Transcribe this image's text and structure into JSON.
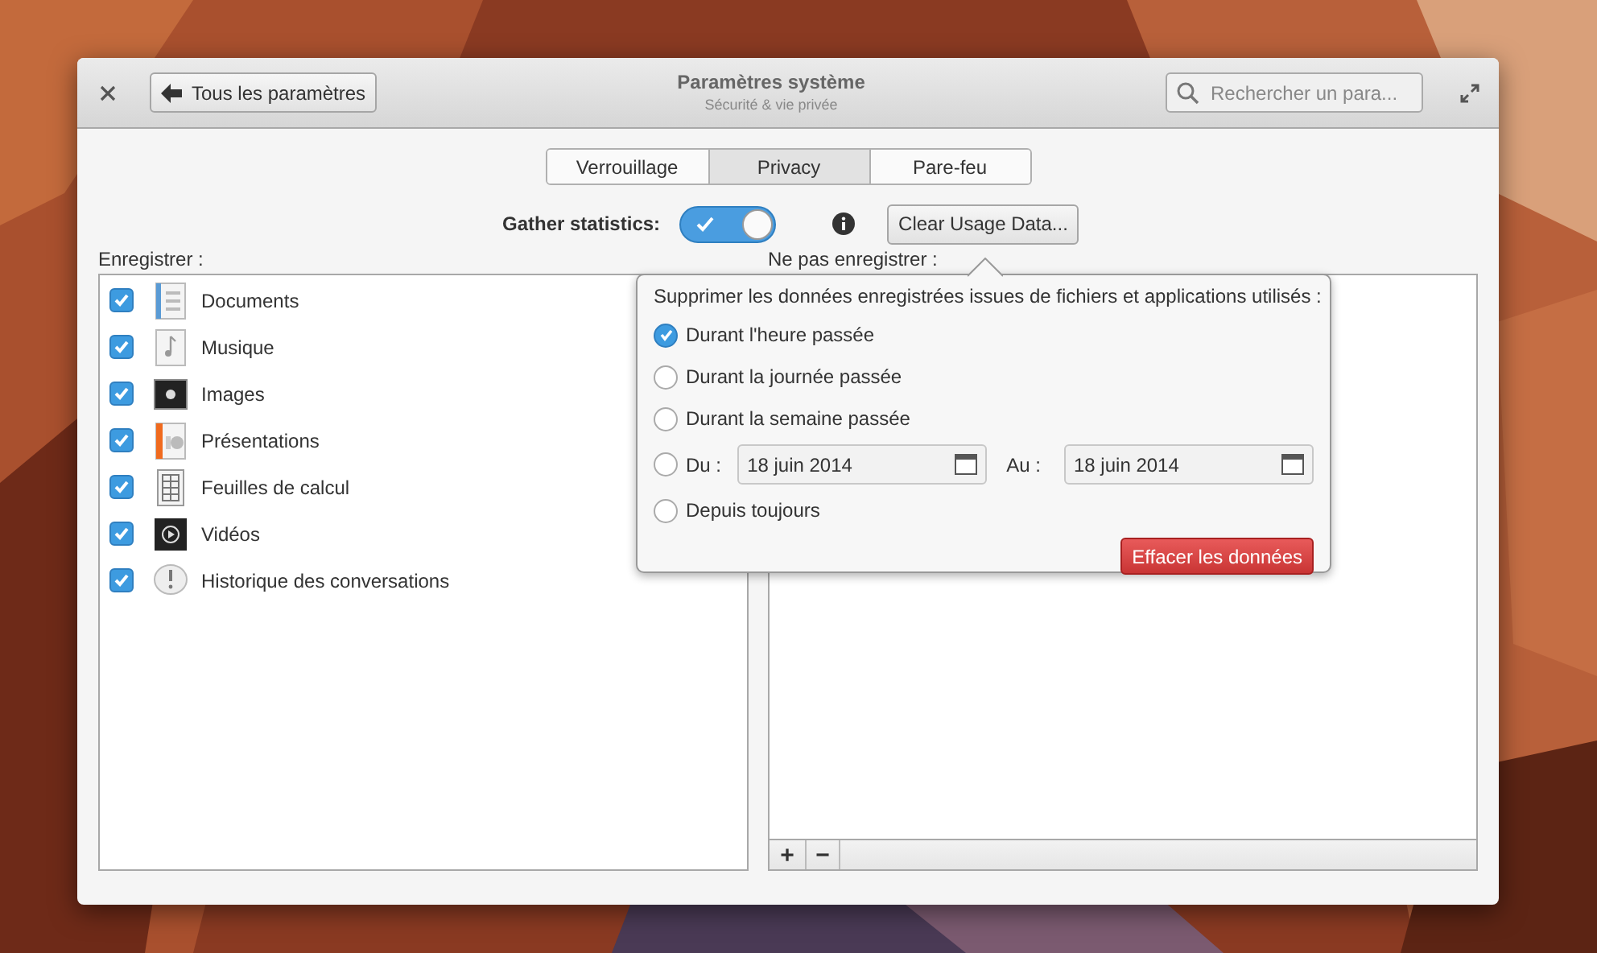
{
  "window": {
    "title": "Paramètres système",
    "subtitle": "Sécurité & vie privée",
    "back_button": "Tous les paramètres",
    "search": {
      "placeholder": "Rechercher un para..."
    }
  },
  "tabs": [
    {
      "label": "Verrouillage",
      "selected": false
    },
    {
      "label": "Privacy",
      "selected": true
    },
    {
      "label": "Pare-feu",
      "selected": false
    }
  ],
  "gather": {
    "label": "Gather statistics:",
    "on": true,
    "clear_button": "Clear Usage Data..."
  },
  "record": {
    "label": "Enregistrer :",
    "items": [
      {
        "label": "Documents",
        "checked": true
      },
      {
        "label": "Musique",
        "checked": true
      },
      {
        "label": "Images",
        "checked": true
      },
      {
        "label": "Présentations",
        "checked": true
      },
      {
        "label": "Feuilles de calcul",
        "checked": true
      },
      {
        "label": "Vidéos",
        "checked": true
      },
      {
        "label": "Historique des conversations",
        "checked": true
      }
    ]
  },
  "exclude": {
    "label": "Ne pas enregistrer :",
    "add": "+",
    "remove": "−"
  },
  "popover": {
    "title": "Supprimer les données enregistrées issues de fichiers et applications utilisés :",
    "options": [
      {
        "kind": "plain",
        "label": "Durant l'heure passée",
        "selected": true
      },
      {
        "kind": "plain",
        "label": "Durant la journée passée",
        "selected": false
      },
      {
        "kind": "plain",
        "label": "Durant la semaine passée",
        "selected": false
      },
      {
        "kind": "range",
        "label": "Du :",
        "from": "18 juin 2014",
        "to_label": "Au :",
        "to": "18 juin 2014",
        "selected": false
      },
      {
        "kind": "plain",
        "label": "Depuis toujours",
        "selected": false
      }
    ],
    "button": "Effacer les données"
  }
}
